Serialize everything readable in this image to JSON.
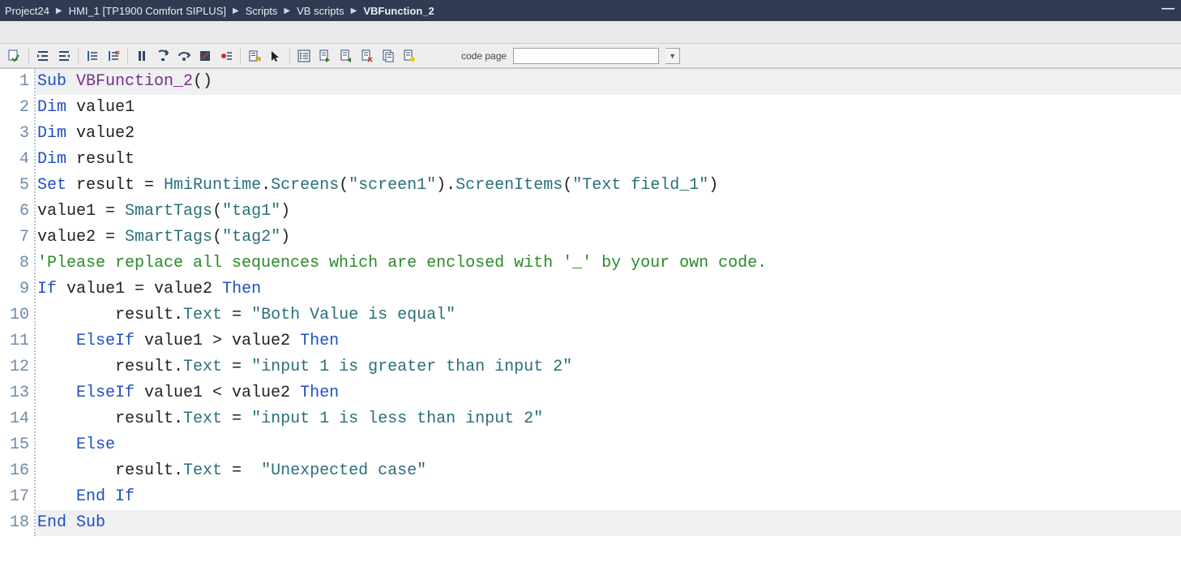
{
  "breadcrumbs": [
    "Project24",
    "HMI_1 [TP1900 Comfort SIPLUS]",
    "Scripts",
    "VB scripts",
    "VBFunction_2"
  ],
  "toolbar": {
    "codepage_label": "code page",
    "codepage_value": ""
  },
  "code": {
    "lines": [
      {
        "n": 1,
        "hl": true,
        "seg": [
          {
            "c": "kw",
            "t": "Sub "
          },
          {
            "c": "fn",
            "t": "VBFunction_2"
          },
          {
            "c": "txt",
            "t": "()"
          }
        ]
      },
      {
        "n": 2,
        "hl": false,
        "seg": [
          {
            "c": "kw",
            "t": "Dim"
          },
          {
            "c": "txt",
            "t": " value1"
          }
        ]
      },
      {
        "n": 3,
        "hl": false,
        "seg": [
          {
            "c": "kw",
            "t": "Dim"
          },
          {
            "c": "txt",
            "t": " value2"
          }
        ]
      },
      {
        "n": 4,
        "hl": false,
        "seg": [
          {
            "c": "kw",
            "t": "Dim"
          },
          {
            "c": "txt",
            "t": " result"
          }
        ]
      },
      {
        "n": 5,
        "hl": false,
        "seg": [
          {
            "c": "kw",
            "t": "Set"
          },
          {
            "c": "txt",
            "t": " result = "
          },
          {
            "c": "mem",
            "t": "HmiRuntime"
          },
          {
            "c": "txt",
            "t": "."
          },
          {
            "c": "mem",
            "t": "Screens"
          },
          {
            "c": "txt",
            "t": "("
          },
          {
            "c": "str",
            "t": "\"screen1\""
          },
          {
            "c": "txt",
            "t": ")."
          },
          {
            "c": "mem",
            "t": "ScreenItems"
          },
          {
            "c": "txt",
            "t": "("
          },
          {
            "c": "str",
            "t": "\"Text field_1\""
          },
          {
            "c": "txt",
            "t": ")"
          }
        ]
      },
      {
        "n": 6,
        "hl": false,
        "seg": [
          {
            "c": "txt",
            "t": "value1 = "
          },
          {
            "c": "mem",
            "t": "SmartTags"
          },
          {
            "c": "txt",
            "t": "("
          },
          {
            "c": "str",
            "t": "\"tag1\""
          },
          {
            "c": "txt",
            "t": ")"
          }
        ]
      },
      {
        "n": 7,
        "hl": false,
        "seg": [
          {
            "c": "txt",
            "t": "value2 = "
          },
          {
            "c": "mem",
            "t": "SmartTags"
          },
          {
            "c": "txt",
            "t": "("
          },
          {
            "c": "str",
            "t": "\"tag2\""
          },
          {
            "c": "txt",
            "t": ")"
          }
        ]
      },
      {
        "n": 8,
        "hl": false,
        "seg": [
          {
            "c": "cmt",
            "t": "'Please replace all sequences which are enclosed with '_' by your own code."
          }
        ]
      },
      {
        "n": 9,
        "hl": false,
        "seg": [
          {
            "c": "kw",
            "t": "If"
          },
          {
            "c": "txt",
            "t": " value1 = value2 "
          },
          {
            "c": "kw",
            "t": "Then"
          }
        ]
      },
      {
        "n": 10,
        "hl": false,
        "seg": [
          {
            "c": "txt",
            "t": "        result."
          },
          {
            "c": "mem",
            "t": "Text"
          },
          {
            "c": "txt",
            "t": " = "
          },
          {
            "c": "str",
            "t": "\"Both Value is equal\""
          }
        ]
      },
      {
        "n": 11,
        "hl": false,
        "seg": [
          {
            "c": "txt",
            "t": "    "
          },
          {
            "c": "kw",
            "t": "ElseIf"
          },
          {
            "c": "txt",
            "t": " value1 > value2 "
          },
          {
            "c": "kw",
            "t": "Then"
          }
        ]
      },
      {
        "n": 12,
        "hl": false,
        "seg": [
          {
            "c": "txt",
            "t": "        result."
          },
          {
            "c": "mem",
            "t": "Text"
          },
          {
            "c": "txt",
            "t": " = "
          },
          {
            "c": "str",
            "t": "\"input 1 is greater than input 2\""
          }
        ]
      },
      {
        "n": 13,
        "hl": false,
        "seg": [
          {
            "c": "txt",
            "t": "    "
          },
          {
            "c": "kw",
            "t": "ElseIf"
          },
          {
            "c": "txt",
            "t": " value1 < value2 "
          },
          {
            "c": "kw",
            "t": "Then"
          }
        ]
      },
      {
        "n": 14,
        "hl": false,
        "seg": [
          {
            "c": "txt",
            "t": "        result."
          },
          {
            "c": "mem",
            "t": "Text"
          },
          {
            "c": "txt",
            "t": " = "
          },
          {
            "c": "str",
            "t": "\"input 1 is less than input 2\""
          }
        ]
      },
      {
        "n": 15,
        "hl": false,
        "seg": [
          {
            "c": "txt",
            "t": "    "
          },
          {
            "c": "kw",
            "t": "Else"
          }
        ]
      },
      {
        "n": 16,
        "hl": false,
        "seg": [
          {
            "c": "txt",
            "t": "        result."
          },
          {
            "c": "mem",
            "t": "Text"
          },
          {
            "c": "txt",
            "t": " =  "
          },
          {
            "c": "str",
            "t": "\"Unexpected case\""
          }
        ]
      },
      {
        "n": 17,
        "hl": false,
        "seg": [
          {
            "c": "txt",
            "t": "    "
          },
          {
            "c": "kw",
            "t": "End If"
          }
        ]
      },
      {
        "n": 18,
        "hl": true,
        "seg": [
          {
            "c": "kw",
            "t": "End Sub"
          }
        ]
      }
    ]
  },
  "icons": [
    "check-script-icon",
    "indent-right-icon",
    "indent-left-icon",
    "format-code-icon",
    "clear-format-icon",
    "pause-icon",
    "step-into-icon",
    "step-over-icon",
    "stop-icon",
    "breakpoint-icon",
    "toggle-bookmark-icon",
    "cursor-icon",
    "object-list-icon",
    "bookmark-next-icon",
    "bookmark-prev-icon",
    "bookmark-clear-icon",
    "copy-tag-icon",
    "highlight-icon"
  ]
}
